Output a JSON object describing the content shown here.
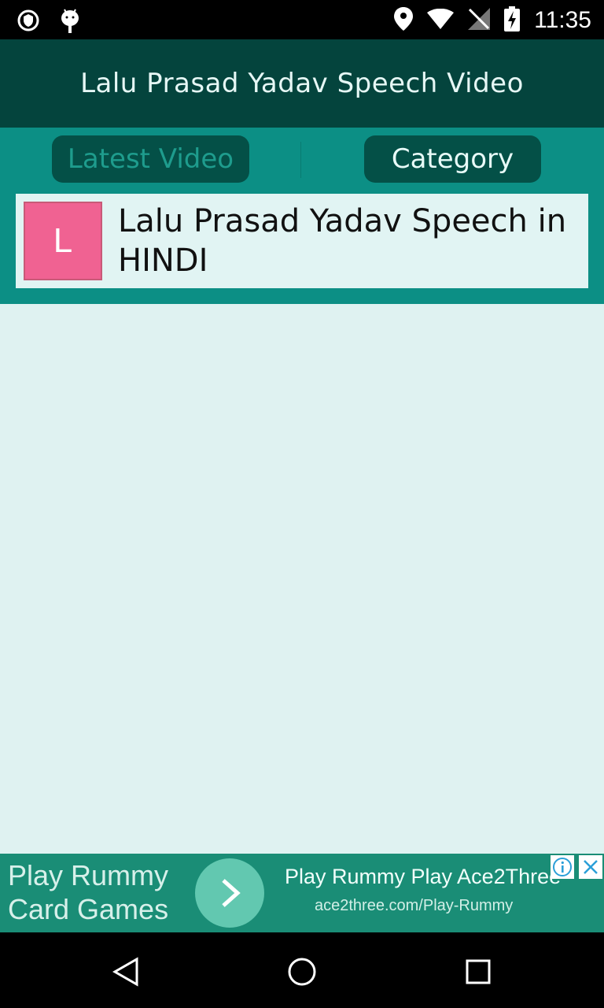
{
  "status_bar": {
    "time": "11:35"
  },
  "app_bar": {
    "title": "Lalu Prasad Yadav Speech Video"
  },
  "tabs": [
    {
      "label": "Latest Video",
      "selected": false
    },
    {
      "label": "Category",
      "selected": true
    }
  ],
  "list": [
    {
      "letter": "L",
      "title": "Lalu Prasad Yadav Speech in HINDI",
      "tile_color": "#f06292"
    }
  ],
  "ad": {
    "left_text_line1": "Play Rummy",
    "left_text_line2": "Card Games",
    "headline": "Play Rummy Play Ace2Three",
    "url": "ace2three.com/Play-Rummy"
  },
  "nav": {
    "back_icon": "back-icon",
    "home_icon": "home-icon",
    "recents_icon": "recents-icon"
  }
}
